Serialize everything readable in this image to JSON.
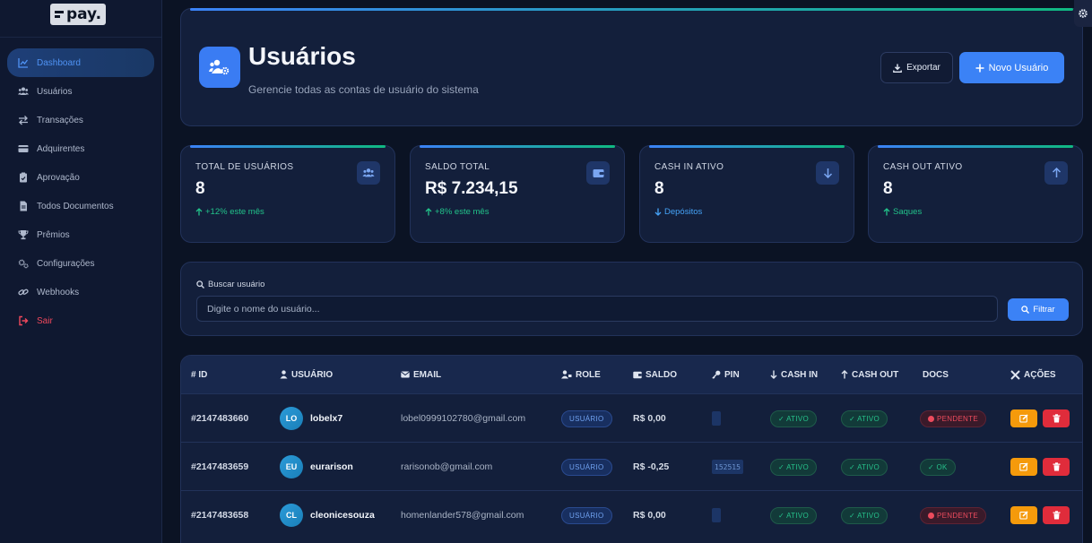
{
  "logo": {
    "text": "pay."
  },
  "sidebar": {
    "items": [
      {
        "label": "Dashboard",
        "icon": "chart-line-icon",
        "active": true
      },
      {
        "label": "Usuários",
        "icon": "users-icon"
      },
      {
        "label": "Transações",
        "icon": "exchange-icon"
      },
      {
        "label": "Adquirentes",
        "icon": "credit-card-icon"
      },
      {
        "label": "Aprovação",
        "icon": "clipboard-check-icon"
      },
      {
        "label": "Todos Documentos",
        "icon": "file-icon"
      },
      {
        "label": "Prêmios",
        "icon": "trophy-icon"
      },
      {
        "label": "Configurações",
        "icon": "cogs-icon"
      },
      {
        "label": "Webhooks",
        "icon": "link-icon"
      },
      {
        "label": "Sair",
        "icon": "sign-out-icon"
      }
    ]
  },
  "header": {
    "title": "Usuários",
    "subtitle": "Gerencie todas as contas de usuário do sistema",
    "export_label": "Exportar",
    "new_user_label": "Novo Usuário"
  },
  "stats": [
    {
      "label": "TOTAL DE USUÁRIOS",
      "value": "8",
      "trend": "+12% este mês",
      "trend_icon": "arrow-up",
      "icon": "users-icon"
    },
    {
      "label": "SALDO TOTAL",
      "value": "R$ 7.234,15",
      "trend": "+8% este mês",
      "trend_icon": "arrow-up",
      "icon": "wallet-icon"
    },
    {
      "label": "CASH IN ATIVO",
      "value": "8",
      "trend": "Depósitos",
      "trend_icon": "arrow-down",
      "icon": "arrow-down-icon"
    },
    {
      "label": "CASH OUT ATIVO",
      "value": "8",
      "trend": "Saques",
      "trend_icon": "arrow-up",
      "icon": "arrow-up-icon"
    }
  ],
  "search": {
    "label": "Buscar usuário",
    "placeholder": "Digite o nome do usuário...",
    "filter_label": "Filtrar"
  },
  "table": {
    "columns": {
      "id": "# ID",
      "user": "USUÁRIO",
      "email": "EMAIL",
      "role": "ROLE",
      "saldo": "SALDO",
      "pin": "PIN",
      "cash_in": "CASH IN",
      "cash_out": "CASH OUT",
      "docs": "DOCS",
      "actions": "AÇÕES"
    },
    "rows": [
      {
        "id": "#2147483660",
        "initials": "LO",
        "username": "lobelx7",
        "email": "lobel0999102780@gmail.com",
        "role": "USUÁRIO",
        "saldo": "R$ 0,00",
        "pin": "",
        "cash_in": "✓ ATIVO",
        "cash_out": "✓ ATIVO",
        "docs": "PENDENTE",
        "docs_status": "pending"
      },
      {
        "id": "#2147483659",
        "initials": "EU",
        "username": "eurarison",
        "email": "rarisonob@gmail.com",
        "role": "USUÁRIO",
        "saldo": "R$ -0,25",
        "pin": "152515",
        "cash_in": "✓ ATIVO",
        "cash_out": "✓ ATIVO",
        "docs": "✓ OK",
        "docs_status": "ok"
      },
      {
        "id": "#2147483658",
        "initials": "CL",
        "username": "cleonicesouza",
        "email": "homenlander578@gmail.com",
        "role": "USUÁRIO",
        "saldo": "R$ 0,00",
        "pin": "",
        "cash_in": "✓ ATIVO",
        "cash_out": "✓ ATIVO",
        "docs": "PENDENTE",
        "docs_status": "pending"
      }
    ]
  }
}
